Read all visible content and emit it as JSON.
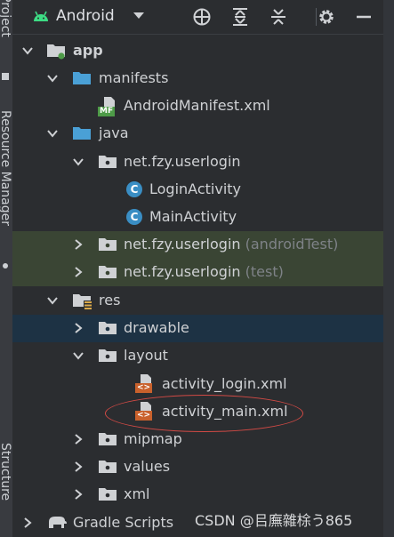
{
  "side_tabs": {
    "project": "Project",
    "resource_manager": "Resource Manager",
    "structure": "Structure"
  },
  "toolbar": {
    "view_label": "Android",
    "icons": [
      "android-icon",
      "chevron-down-icon",
      "crosshair-icon",
      "expand-all-icon",
      "collapse-all-icon",
      "gear-icon",
      "minimize-icon"
    ]
  },
  "tree": {
    "app": "app",
    "manifests": "manifests",
    "android_manifest": "AndroidManifest.xml",
    "mf_badge": "MF",
    "java": "java",
    "pkg_main": "net.fzy.userlogin",
    "class_letter": "C",
    "login_activity": "LoginActivity",
    "main_activity": "MainActivity",
    "pkg_android_test": "net.fzy.userlogin",
    "pkg_android_test_suffix": "(androidTest)",
    "pkg_test": "net.fzy.userlogin",
    "pkg_test_suffix": "(test)",
    "res": "res",
    "drawable": "drawable",
    "layout": "layout",
    "activity_login": "activity_login.xml",
    "activity_main": "activity_main.xml",
    "xml_badge": "<>",
    "mipmap": "mipmap",
    "values": "values",
    "xml": "xml",
    "gradle_scripts": "Gradle Scripts"
  },
  "colors": {
    "selection": "#1d3244",
    "test_highlight": "#3a4534",
    "folder": "#4aa0d6",
    "annotation": "#d24a45"
  },
  "watermark": "CSDN @㠯廡雜梌う865"
}
